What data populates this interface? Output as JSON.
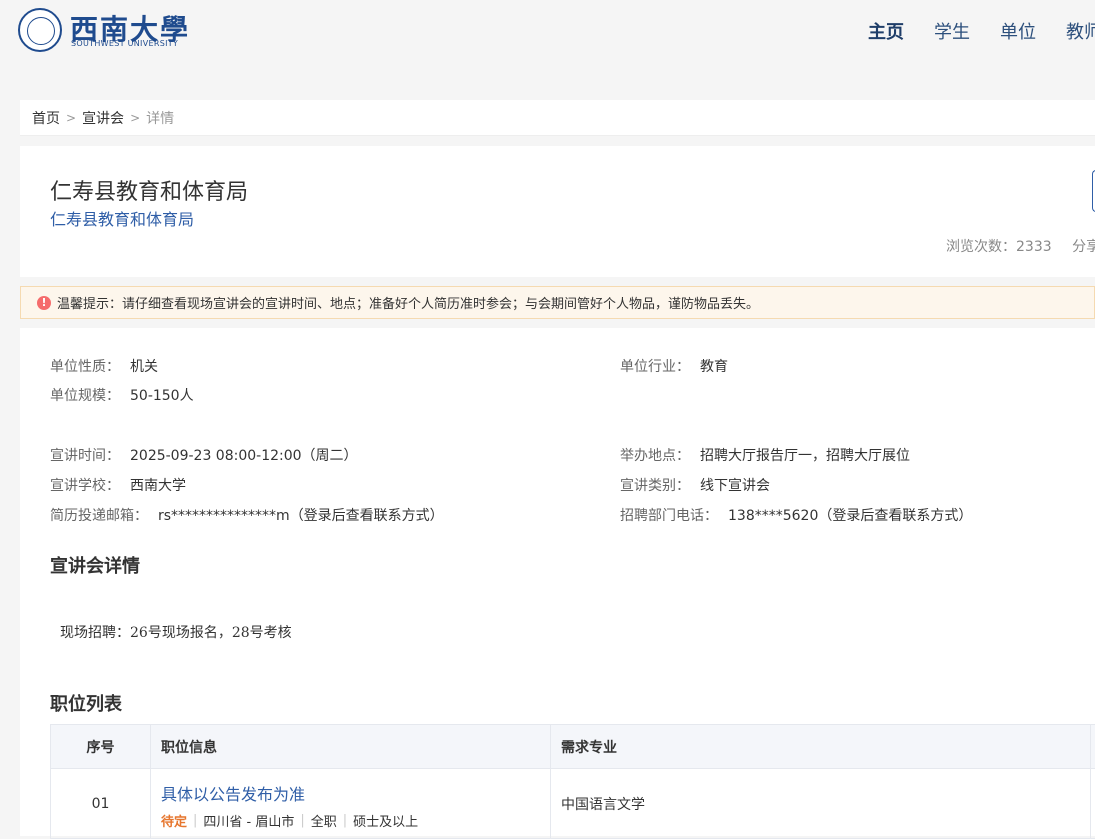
{
  "header": {
    "logo_cn": "西南大學",
    "logo_en": "SOUTHWEST UNIVERSITY",
    "nav": [
      {
        "label": "主页",
        "active": true
      },
      {
        "label": "学生",
        "active": false
      },
      {
        "label": "单位",
        "active": false
      },
      {
        "label": "教师",
        "active": false
      }
    ]
  },
  "breadcrumb": {
    "home": "首页",
    "section": "宣讲会",
    "current": "详情"
  },
  "title_card": {
    "title": "仁寿县教育和体育局",
    "company": "仁寿县教育和体育局",
    "views_label": "浏览次数：",
    "views": "2333",
    "share": "分享"
  },
  "notice": {
    "icon": "alert-icon",
    "text": "温馨提示：请仔细查看现场宣讲会的宣讲时间、地点；准备好个人简历准时参会；与会期间管好个人物品，谨防物品丢失。"
  },
  "info": {
    "nature_label": "单位性质：",
    "nature": "机关",
    "industry_label": "单位行业：",
    "industry": "教育",
    "scale_label": "单位规模：",
    "scale": "50-150人",
    "time_label": "宣讲时间：",
    "time": "2025-09-23 08:00-12:00（周二）",
    "place_label": "举办地点：",
    "place": "招聘大厅报告厅一，招聘大厅展位",
    "school_label": "宣讲学校：",
    "school": "西南大学",
    "type_label": "宣讲类别：",
    "type": "线下宣讲会",
    "email_label": "简历投递邮箱：",
    "email": "rs***************m（登录后查看联系方式）",
    "phone_label": "招聘部门电话：",
    "phone": "138****5620（登录后查看联系方式）"
  },
  "detail": {
    "title": "宣讲会详情",
    "text": "现场招聘：26号现场报名，28号考核"
  },
  "jobs": {
    "title": "职位列表",
    "columns": [
      "序号",
      "职位信息",
      "需求专业"
    ],
    "rows": [
      {
        "no": "01",
        "title": "具体以公告发布为准",
        "status": "待定",
        "location": "四川省 - 眉山市",
        "job_type": "全职",
        "degree": "硕士及以上",
        "major": "中国语言文学"
      }
    ]
  },
  "colors": {
    "brand": "#1f4b8e",
    "link": "#2f5ea7",
    "status_pending": "#e6762e",
    "notice_bg": "#fdf6ec",
    "alert": "#f56c6c"
  }
}
